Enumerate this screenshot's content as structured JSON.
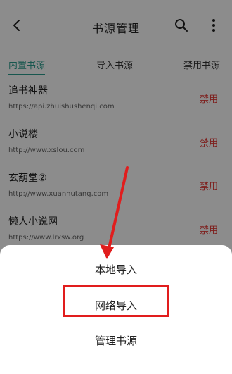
{
  "header": {
    "title": "书源管理"
  },
  "tabs": [
    {
      "label": "内置书源",
      "active": true
    },
    {
      "label": "导入书源",
      "active": false
    },
    {
      "label": "禁用书源",
      "active": false
    }
  ],
  "sources": [
    {
      "name": "追书神器",
      "url": "https://api.zhuishushenqi.com",
      "action": "禁用"
    },
    {
      "name": "小说楼",
      "url": "http://www.xslou.com",
      "action": "禁用"
    },
    {
      "name": "玄葫堂②",
      "url": "http://www.xuanhutang.com",
      "action": "禁用"
    },
    {
      "name": "懒人小说网",
      "url": "https://www.lrxsw.org",
      "action": "禁用"
    }
  ],
  "sheet": {
    "items": [
      {
        "label": "本地导入"
      },
      {
        "label": "网络导入"
      },
      {
        "label": "管理书源"
      }
    ]
  },
  "colors": {
    "accent": "#2a9d8f",
    "danger": "#e53935",
    "annotation": "#e11d1d",
    "overlay": "rgba(0,0,0,0.45)"
  },
  "icons": [
    "back-icon",
    "search-icon",
    "more-vert-icon"
  ]
}
